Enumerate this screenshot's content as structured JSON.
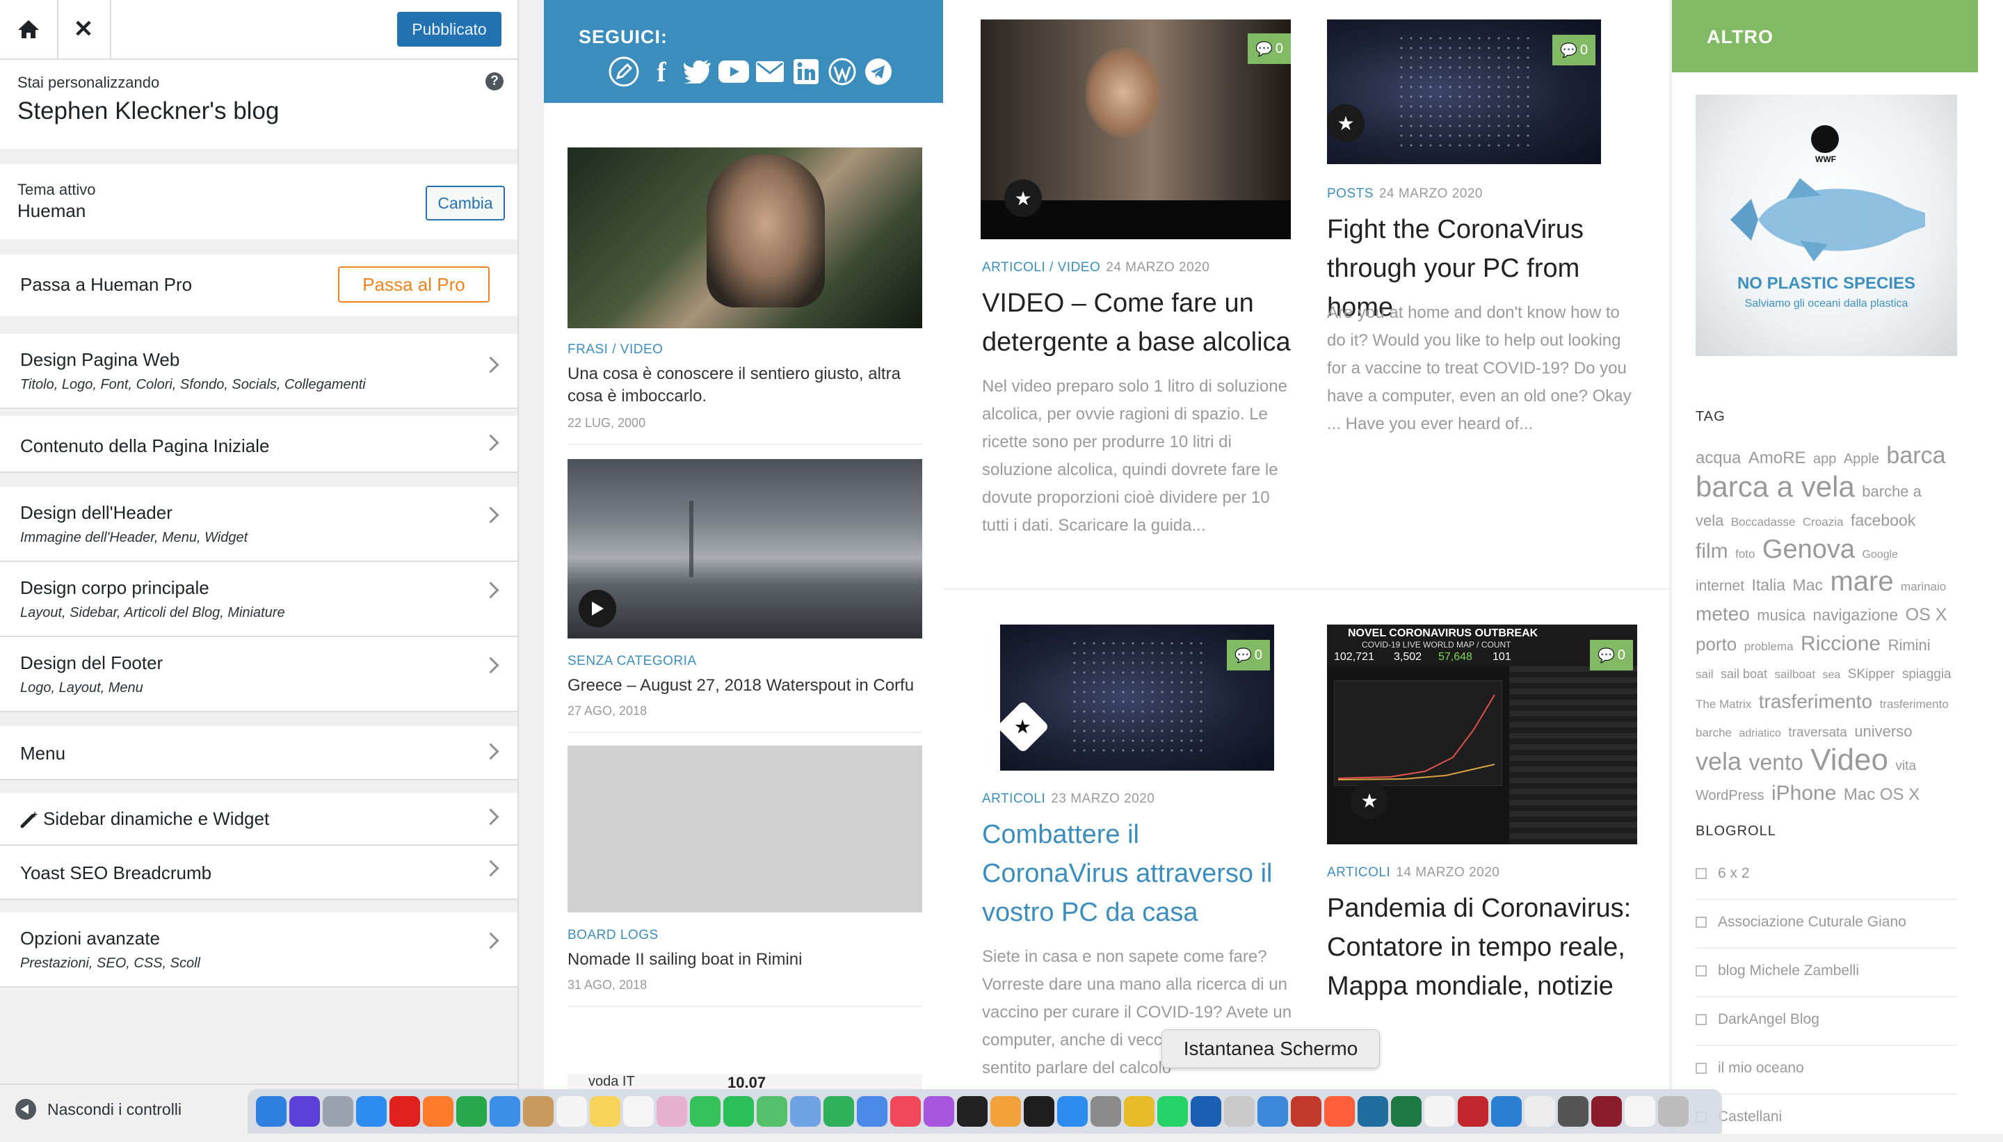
{
  "customizer": {
    "publish_label": "Pubblicato",
    "customizing_label": "Stai personalizzando",
    "site_name": "Stephen Kleckner's blog",
    "help_glyph": "?",
    "active_theme_label": "Tema attivo",
    "active_theme": "Hueman",
    "change_label": "Cambia",
    "pro_label": "Passa a Hueman Pro",
    "pro_button": "Passa al Pro",
    "sections": [
      {
        "title": "Design Pagina Web",
        "desc": "Titolo, Logo, Font, Colori, Sfondo, Socials, Collegamenti"
      },
      {
        "title": "Contenuto della Pagina Iniziale",
        "desc": ""
      },
      {
        "title": "Design dell'Header",
        "desc": "Immagine dell'Header, Menu, Widget"
      },
      {
        "title": "Design corpo principale",
        "desc": "Layout, Sidebar, Articoli del Blog, Miniature"
      },
      {
        "title": "Design del Footer",
        "desc": "Logo, Layout, Menu"
      },
      {
        "title": "Menu",
        "desc": ""
      },
      {
        "title": "Sidebar dinamiche e Widget",
        "desc": ""
      },
      {
        "title": "Yoast SEO Breadcrumb",
        "desc": ""
      },
      {
        "title": "Opzioni avanzate",
        "desc": "Prestazioni, SEO, CSS, Scoll"
      }
    ],
    "hide_controls": "Nascondi i controlli"
  },
  "preview": {
    "follow_label": "SEGUICI:",
    "other_label": "ALTRO",
    "small_posts": [
      {
        "cat": "FRASI",
        "cat2": "VIDEO",
        "title": "Una cosa è conoscere il sentiero giusto, altra cosa è imboccarlo.",
        "date": "22 LUG, 2000"
      },
      {
        "cat": "SENZA CATEGORIA",
        "title": "Greece – August 27, 2018 Waterspout in Corfu",
        "date": "27 AGO, 2018"
      },
      {
        "cat": "BOARD LOGS",
        "title": "Nomade II sailing boat in Rimini",
        "date": "31 AGO, 2018"
      }
    ],
    "ticker_text": "voda IT",
    "ticker_value": "10.07",
    "posts": [
      {
        "cat": "ARTICOLI",
        "cat2": "VIDEO",
        "date": "24 MARZO 2020",
        "title": "VIDEO – Come fare un detergente a base alcolica",
        "excerpt": "Nel video preparo solo 1 litro di soluzione alcolica, per ovvie ragioni di spazio. Le ricette sono per produrre 10 litri di soluzione alcolica, quindi dovrete fare le dovute proporzioni cioè dividere per 10 tutti i dati. Scaricare la guida...",
        "comments": "0"
      },
      {
        "cat": "POSTS",
        "date": "24 MARZO 2020",
        "title": "Fight the CoronaVirus through your PC from home",
        "excerpt": "Are you at home and don't know how to do it? Would you like to help out looking for a vaccine to treat COVID-19? Do you have a computer, even an old one? Okay ... Have you ever heard of...",
        "comments": "0"
      },
      {
        "cat": "ARTICOLI",
        "date": "23 MARZO 2020",
        "title": "Combattere il CoronaVirus attraverso il vostro PC da casa",
        "excerpt": "Siete in casa e non sapete come fare? Vorreste dare una mano alla ricerca di un vaccino per curare il COVID-19? Avete un computer, anche di vecchi... Avete mai sentito parlare del calcolo",
        "comments": "0"
      },
      {
        "cat": "ARTICOLI",
        "date": "14 MARZO 2020",
        "title": "Pandemia di Coronavirus: Contatore in tempo reale, Mappa mondiale, notizie",
        "excerpt": "",
        "comments": "0"
      }
    ],
    "corona_header": "NOVEL CORONAVIRUS OUTBREAK",
    "corona_sub": "COVID-19 LIVE WORLD MAP / COUNT",
    "corona_numbers": [
      "102,721",
      "3,502",
      "57,648",
      "101"
    ],
    "ad_title": "NO PLASTIC SPECIES",
    "ad_sub": "Salviamo gli oceani dalla plastica",
    "ad_brand": "WWF",
    "tag_heading": "TAG",
    "tags": [
      {
        "t": "acqua",
        "s": 24
      },
      {
        "t": "AmoRE",
        "s": 24
      },
      {
        "t": "app",
        "s": 20
      },
      {
        "t": "Apple",
        "s": 20
      },
      {
        "t": "barca",
        "s": 34
      },
      {
        "t": "barca a vela",
        "s": 42
      },
      {
        "t": "barche a vela",
        "s": 22
      },
      {
        "t": "Boccadasse",
        "s": 17
      },
      {
        "t": "Croazia",
        "s": 17
      },
      {
        "t": "facebook",
        "s": 23
      },
      {
        "t": "film",
        "s": 30
      },
      {
        "t": "foto",
        "s": 17
      },
      {
        "t": "Genova",
        "s": 38
      },
      {
        "t": "Google",
        "s": 16
      },
      {
        "t": "internet",
        "s": 21
      },
      {
        "t": "Italia",
        "s": 23
      },
      {
        "t": "Mac",
        "s": 23
      },
      {
        "t": "mare",
        "s": 40
      },
      {
        "t": "marinaio",
        "s": 17
      },
      {
        "t": "meteo",
        "s": 28
      },
      {
        "t": "musica",
        "s": 22
      },
      {
        "t": "navigazione",
        "s": 23
      },
      {
        "t": "OS X",
        "s": 25
      },
      {
        "t": "porto",
        "s": 26
      },
      {
        "t": "problema",
        "s": 17
      },
      {
        "t": "Riccione",
        "s": 30
      },
      {
        "t": "Rimini",
        "s": 22
      },
      {
        "t": "sail",
        "s": 17
      },
      {
        "t": "sail boat",
        "s": 18
      },
      {
        "t": "sailboat",
        "s": 17
      },
      {
        "t": "sea",
        "s": 16
      },
      {
        "t": "SKipper",
        "s": 19
      },
      {
        "t": "spiaggia",
        "s": 19
      },
      {
        "t": "The Matrix",
        "s": 17
      },
      {
        "t": "trasferimento",
        "s": 28
      },
      {
        "t": "trasferimento barche",
        "s": 17
      },
      {
        "t": "adriatico",
        "s": 16
      },
      {
        "t": "traversata",
        "s": 19
      },
      {
        "t": "universo",
        "s": 22
      },
      {
        "t": "vela",
        "s": 36
      },
      {
        "t": "vento",
        "s": 32
      },
      {
        "t": "Video",
        "s": 44
      },
      {
        "t": "vita",
        "s": 19
      },
      {
        "t": "WordPress",
        "s": 20
      },
      {
        "t": "iPhone",
        "s": 30
      },
      {
        "t": "Mac OS X",
        "s": 24
      }
    ],
    "blogroll_heading": "BLOGROLL",
    "blogroll": [
      "6 x 2",
      "Associazione Cuturale Giano",
      "blog Michele Zambelli",
      "DarkAngel Blog",
      "il mio oceano",
      "Castellani"
    ]
  },
  "dock": {
    "tooltip": "Istantanea Schermo",
    "apps": [
      "Finder",
      "Siri",
      "Launchpad",
      "Safari",
      "Opera",
      "Firefox",
      "Chrome",
      "Mail",
      "Contacts",
      "Calendar",
      "Notes",
      "Reminders",
      "Photos",
      "Messages",
      "FaceTime",
      "Maps",
      "Preview",
      "Numbers",
      "Keynote",
      "Music",
      "Podcasts",
      "TV",
      "Books",
      "Terminal",
      "App Store",
      "System Preferences",
      "Chrome Canary",
      "WhatsApp",
      "VirtualBox",
      "Screenshot",
      "Remote Desktop",
      "Photo Booth",
      "Firefox Dev",
      "Wireshark",
      "Excel",
      "TextEdit",
      "FileZilla",
      "VS Code",
      "Document",
      "Activity",
      "Game",
      "Drive",
      "Trash"
    ]
  }
}
